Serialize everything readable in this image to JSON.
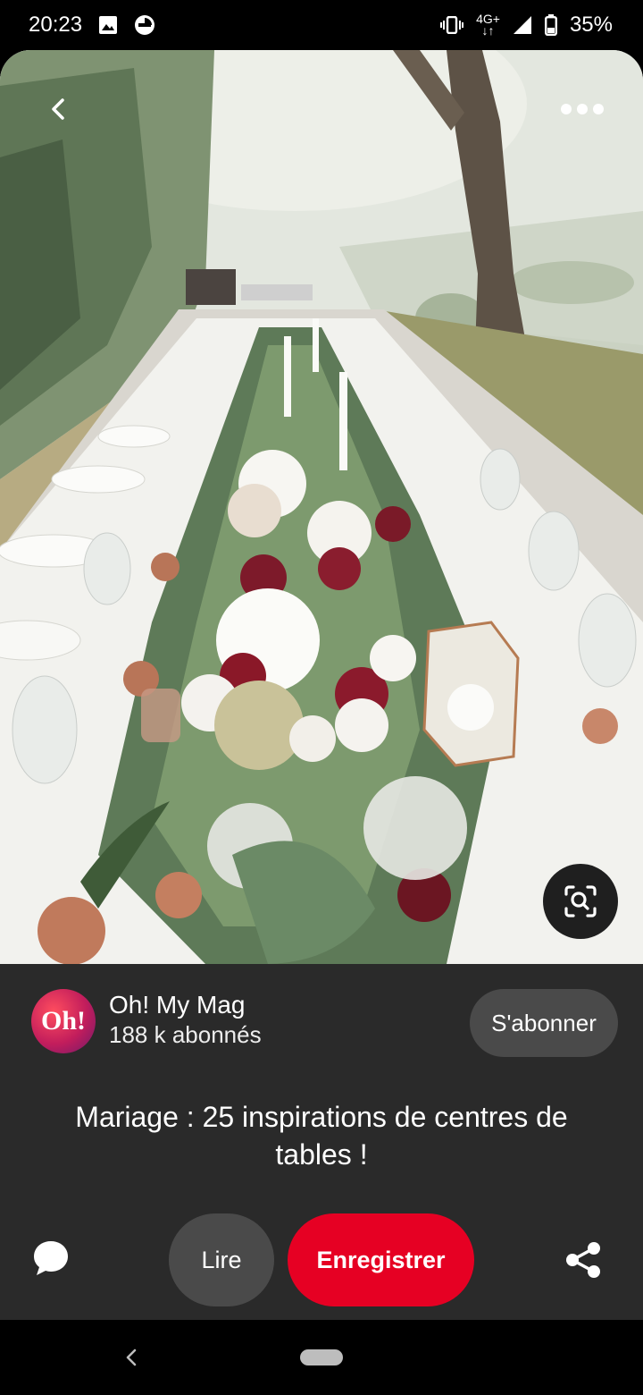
{
  "status_bar": {
    "time": "20:23",
    "network_top": "4G+",
    "network_bottom": "↓↑",
    "battery": "35%",
    "icons": [
      "image-icon",
      "sync-icon",
      "vibrate-icon",
      "signal-icon",
      "battery-icon"
    ]
  },
  "pin": {
    "title": "Mariage : 25 inspirations de centres de tables !",
    "image_icons": [
      "back-arrow-icon",
      "more-icon",
      "visual-search-icon"
    ]
  },
  "profile": {
    "avatar_text": "Oh!",
    "name": "Oh! My Mag",
    "followers": "188 k abonnés",
    "subscribe_label": "S'abonner"
  },
  "actions": {
    "read_label": "Lire",
    "save_label": "Enregistrer",
    "comment_icon": "comment-icon",
    "share_icon": "share-icon"
  },
  "colors": {
    "save_button": "#e60023",
    "panel_background": "#2a2a2a",
    "secondary_button": "#4a4a4a"
  }
}
